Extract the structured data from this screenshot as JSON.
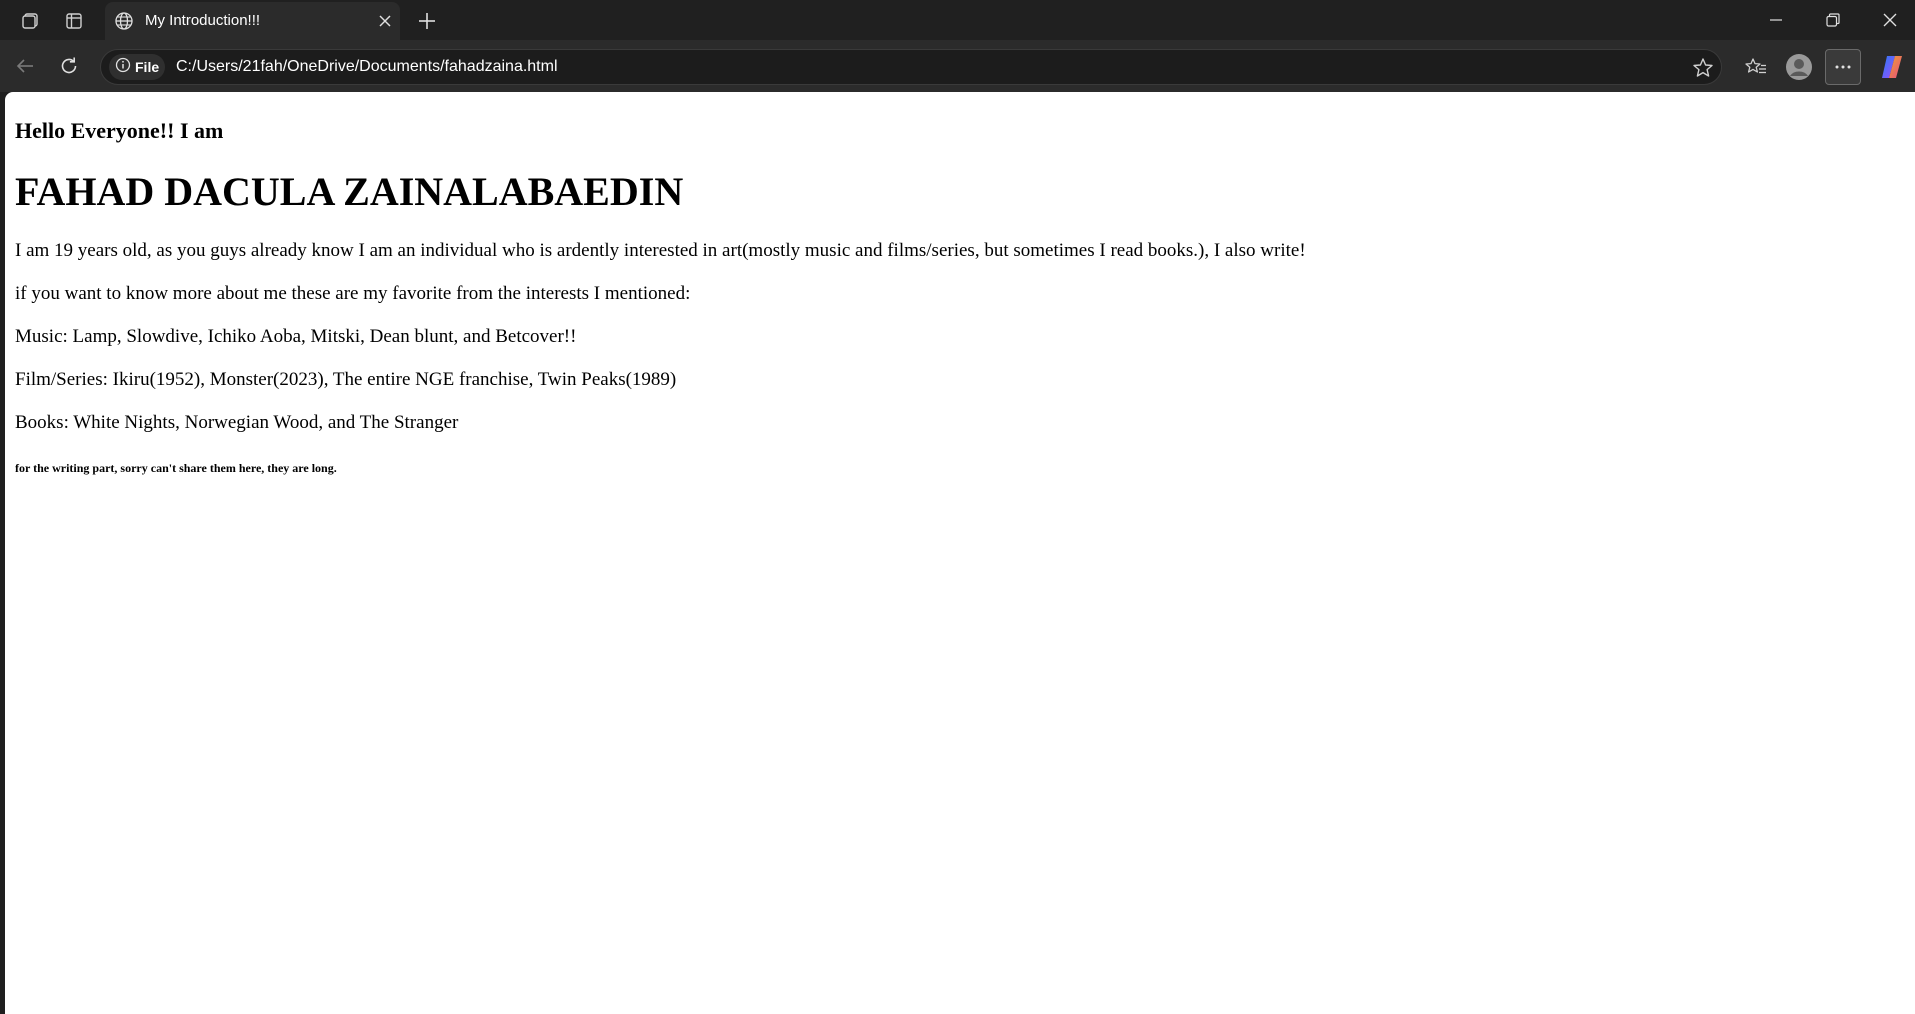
{
  "browser": {
    "tab": {
      "title": "My Introduction!!!"
    },
    "address_bar": {
      "site_info_label": "File",
      "url": "C:/Users/21fah/OneDrive/Documents/fahadzaina.html"
    },
    "colors": {
      "chrome_bg": "#202020",
      "toolbar_bg": "#2b2b2b",
      "page_bg": "#ffffff",
      "text": "#ffffff"
    },
    "icons": [
      "workspaces-icon",
      "tab-actions-icon",
      "globe-icon",
      "close-tab-icon",
      "new-tab-icon",
      "minimize-icon",
      "restore-icon",
      "close-window-icon",
      "back-icon",
      "refresh-icon",
      "info-icon",
      "star-icon",
      "favorites-icon",
      "profile-icon",
      "more-icon",
      "copilot-icon"
    ]
  },
  "page": {
    "greeting": "Hello Everyone!! I am",
    "name": "FAHAD DACULA ZAINALABAEDIN",
    "intro": "I am 19 years old, as you guys already know I am an individual who is ardently interested in art(mostly music and films/series, but sometimes I read books.), I also write!",
    "favorites_lead": "if you want to know more about me these are my favorite from the interests I mentioned:",
    "music": "Music: Lamp, Slowdive, Ichiko Aoba, Mitski, Dean blunt, and Betcover!!",
    "films": "Film/Series: Ikiru(1952), Monster(2023), The entire NGE franchise, Twin Peaks(1989)",
    "books": "Books: White Nights, Norwegian Wood, and The Stranger",
    "writing_note": "for the writing part, sorry can't share them here, they are long."
  }
}
